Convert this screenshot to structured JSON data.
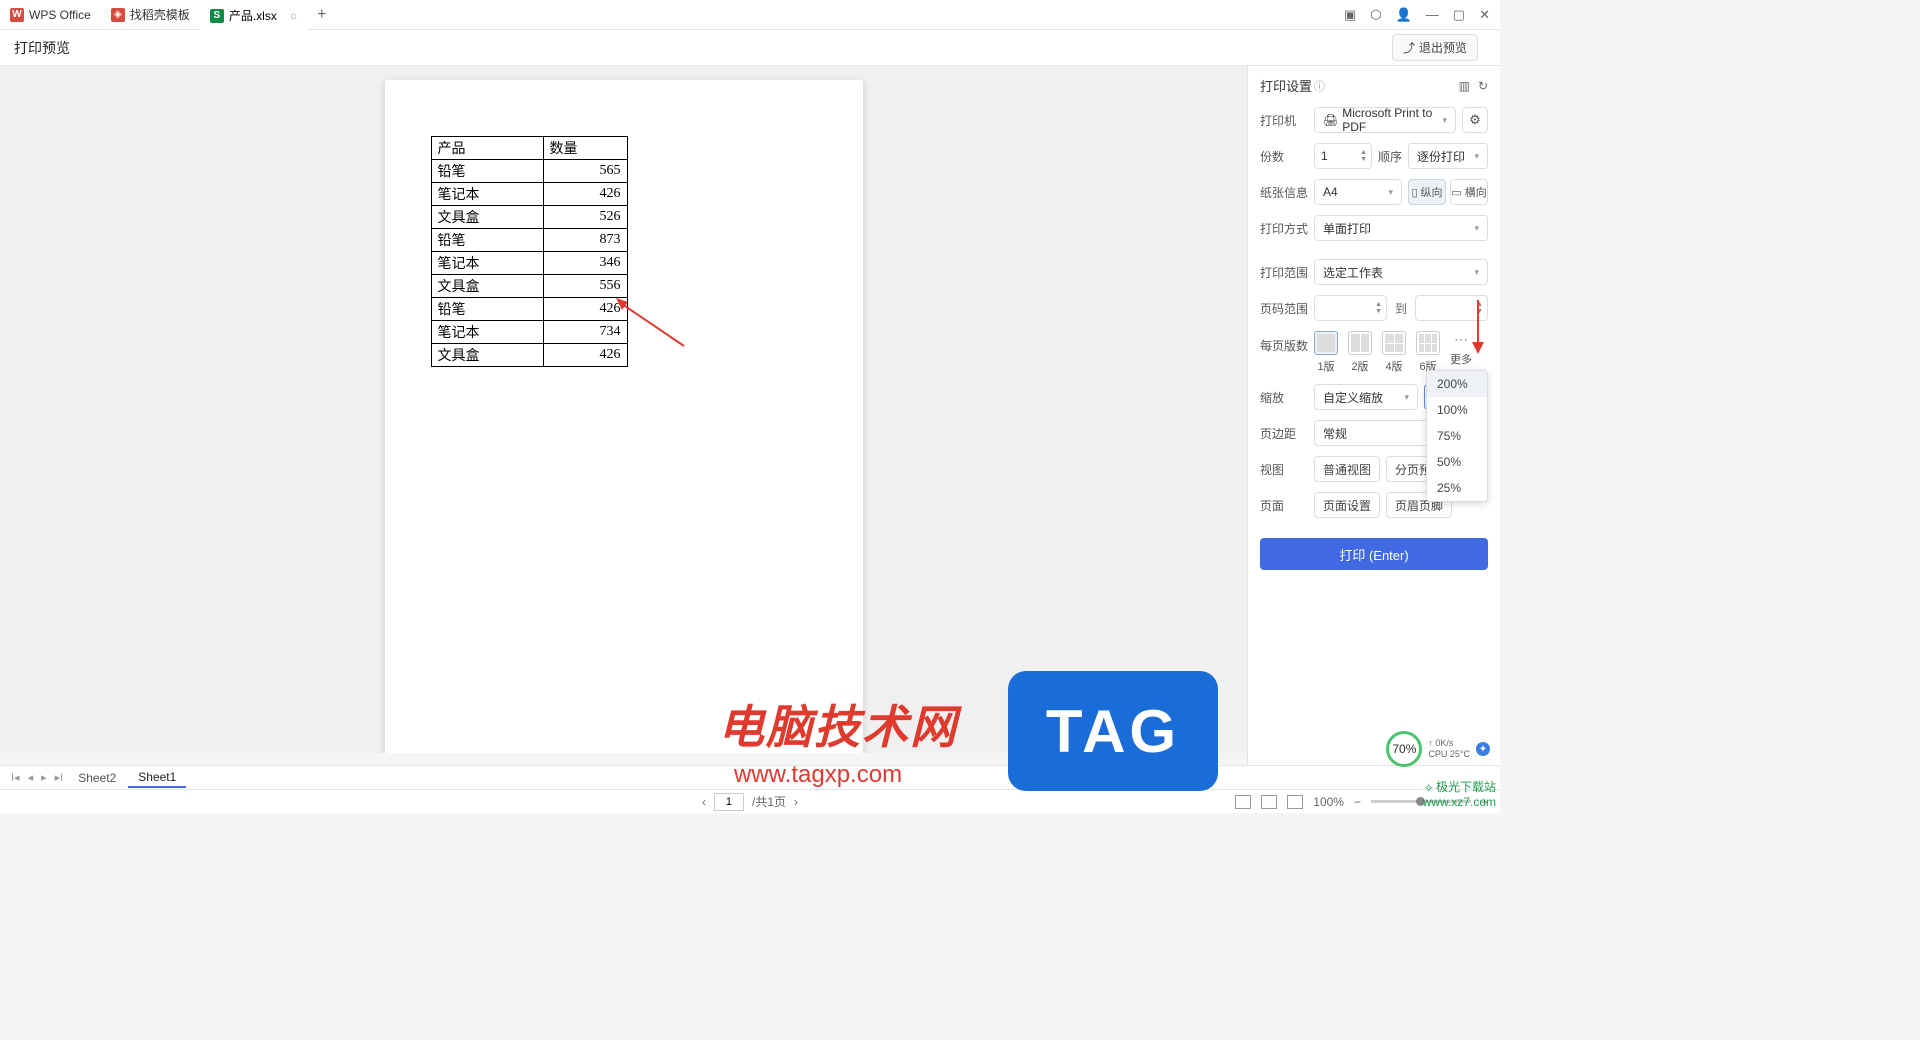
{
  "titlebar": {
    "app_tab": "WPS Office",
    "template_tab": "找稻壳模板",
    "file_tab": "产品.xlsx",
    "add": "+"
  },
  "header": {
    "title": "打印预览",
    "exit": "退出预览"
  },
  "table": {
    "headers": [
      "产品",
      "数量"
    ],
    "rows": [
      [
        "铅笔",
        "565"
      ],
      [
        "笔记本",
        "426"
      ],
      [
        "文具盒",
        "526"
      ],
      [
        "铅笔",
        "873"
      ],
      [
        "笔记本",
        "346"
      ],
      [
        "文具盒",
        "556"
      ],
      [
        "铅笔",
        "426"
      ],
      [
        "笔记本",
        "734"
      ],
      [
        "文具盒",
        "426"
      ]
    ]
  },
  "panel": {
    "title": "打印设置",
    "printer_label": "打印机",
    "printer_value": "Microsoft Print to PDF",
    "copies_label": "份数",
    "copies_value": "1",
    "order_label": "顺序",
    "order_value": "逐份打印",
    "paper_label": "纸张信息",
    "paper_value": "A4",
    "portrait": "纵向",
    "landscape": "横向",
    "side_label": "打印方式",
    "side_value": "单面打印",
    "range_label": "打印范围",
    "range_value": "选定工作表",
    "pages_label": "页码范围",
    "pages_to": "到",
    "layout_label": "每页版数",
    "layout_1": "1版",
    "layout_2": "2版",
    "layout_4": "4版",
    "layout_6": "6版",
    "layout_more": "更多",
    "scale_label": "缩放",
    "scale_value": "自定义缩放",
    "scale_pct": "200%",
    "margin_label": "页边距",
    "margin_value": "常规",
    "view_label": "视图",
    "view_normal": "普通视图",
    "view_page": "分页预览",
    "page_label": "页面",
    "page_setup": "页面设置",
    "page_header": "页眉页脚",
    "print_btn": "打印 (Enter)",
    "zoom_options": [
      "200%",
      "100%",
      "75%",
      "50%",
      "25%"
    ]
  },
  "sheets": {
    "s1": "Sheet2",
    "s2": "Sheet1"
  },
  "status": {
    "page_current": "1",
    "page_total": "/共1页",
    "zoom": "100%"
  },
  "watermark": {
    "t1": "电脑技术网",
    "t1b": "www.tagxp.com",
    "t2": "TAG",
    "t3a": "极光下载站",
    "t3b": "www.xz7.com"
  },
  "perf": {
    "pct": "70%",
    "net": "0K/s",
    "cpu": "CPU 25°C"
  }
}
